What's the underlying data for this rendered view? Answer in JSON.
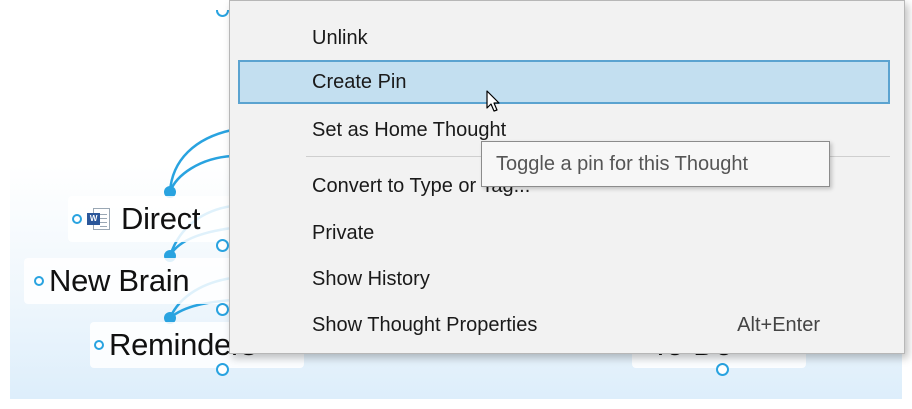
{
  "background_thoughts": {
    "directory": "Direct",
    "new_brain": "New Brain",
    "reminders": "Reminders",
    "todo": "To-Do",
    "word_badge": "W"
  },
  "context_menu": {
    "items": [
      {
        "label": "Unlink",
        "shortcut": ""
      },
      {
        "label": "Create Pin",
        "shortcut": "",
        "highlighted": true
      },
      {
        "label": "Set as Home Thought",
        "shortcut": ""
      },
      {
        "label": "Convert to Type or Tag...",
        "shortcut": ""
      },
      {
        "label": "Private",
        "shortcut": ""
      },
      {
        "label": "Show History",
        "shortcut": ""
      },
      {
        "label": "Show Thought Properties",
        "shortcut": "Alt+Enter"
      }
    ]
  },
  "tooltip": {
    "text": "Toggle a pin for this Thought"
  },
  "colors": {
    "link_line": "#29a3e0",
    "menu_background": "#f2f2f2",
    "menu_highlight": "#c3dff0",
    "menu_highlight_border": "#5ba3d0",
    "word_blue": "#2b579a"
  },
  "icons": {
    "thought_gate": "circle-outline",
    "word_document": "word-document-icon",
    "cursor": "arrow-pointer"
  }
}
